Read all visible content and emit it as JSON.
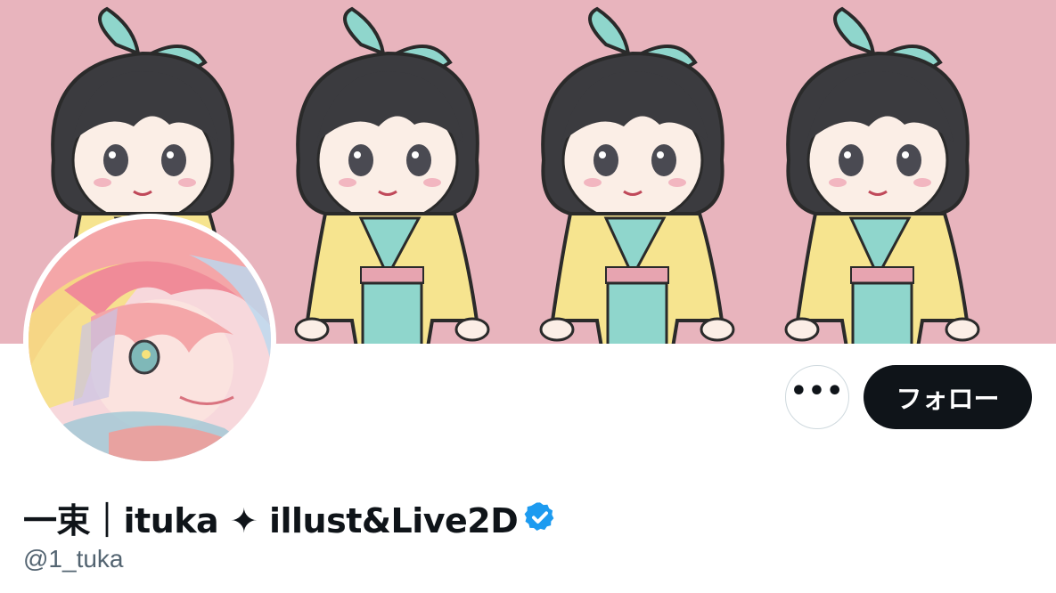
{
  "profile": {
    "display_name": "一束｜ituka ✦ illust&Live2D",
    "handle": "@1_tuka",
    "verified": true
  },
  "actions": {
    "more_label": "•••",
    "follow_label": "フォロー"
  },
  "colors": {
    "banner_background": "#e8b4bd",
    "follow_button_bg": "#0f1419",
    "verified_badge": "#1d9bf0",
    "handle_text": "#536471"
  },
  "icons": {
    "more": "more-horizontal-icon",
    "verified": "verified-badge-icon"
  }
}
